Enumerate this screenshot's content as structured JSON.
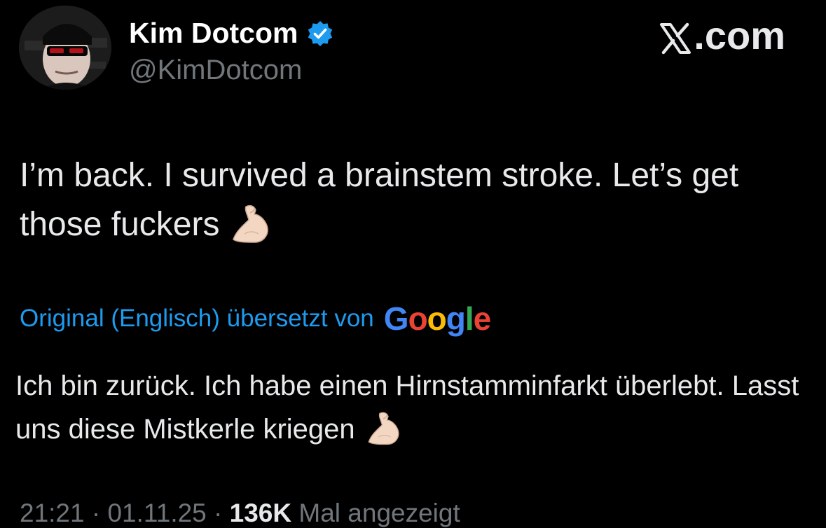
{
  "author": {
    "display_name": "Kim Dotcom",
    "handle": "@KimDotcom",
    "verified": true,
    "avatar_icon": "profile-photo"
  },
  "brand": {
    "label": ".com",
    "icon": "x-logo-icon"
  },
  "tweet": {
    "text": "I’m back. I survived a brainstem stroke. Let’s get those fuckers",
    "emoji": "flexed-biceps"
  },
  "translation": {
    "note": "Original (Englisch) übersetzt von",
    "provider_letters": [
      "G",
      "o",
      "o",
      "g",
      "l",
      "e"
    ],
    "text": "Ich bin zurück. Ich habe einen Hirnstamminfarkt überlebt. Lasst uns diese Mistkerle kriegen"
  },
  "meta": {
    "time": "21:21",
    "separator": "·",
    "date": "01.11.25",
    "views": "136K",
    "views_suffix": "Mal angezeigt"
  },
  "colors": {
    "background": "#000000",
    "text": "#e7e9ea",
    "secondary": "#71767b",
    "link": "#1d9bf0",
    "verified": "#1d9bf0",
    "google_blue": "#4285f4",
    "google_red": "#ea4335",
    "google_yellow": "#fbbc05",
    "google_green": "#34a853"
  }
}
